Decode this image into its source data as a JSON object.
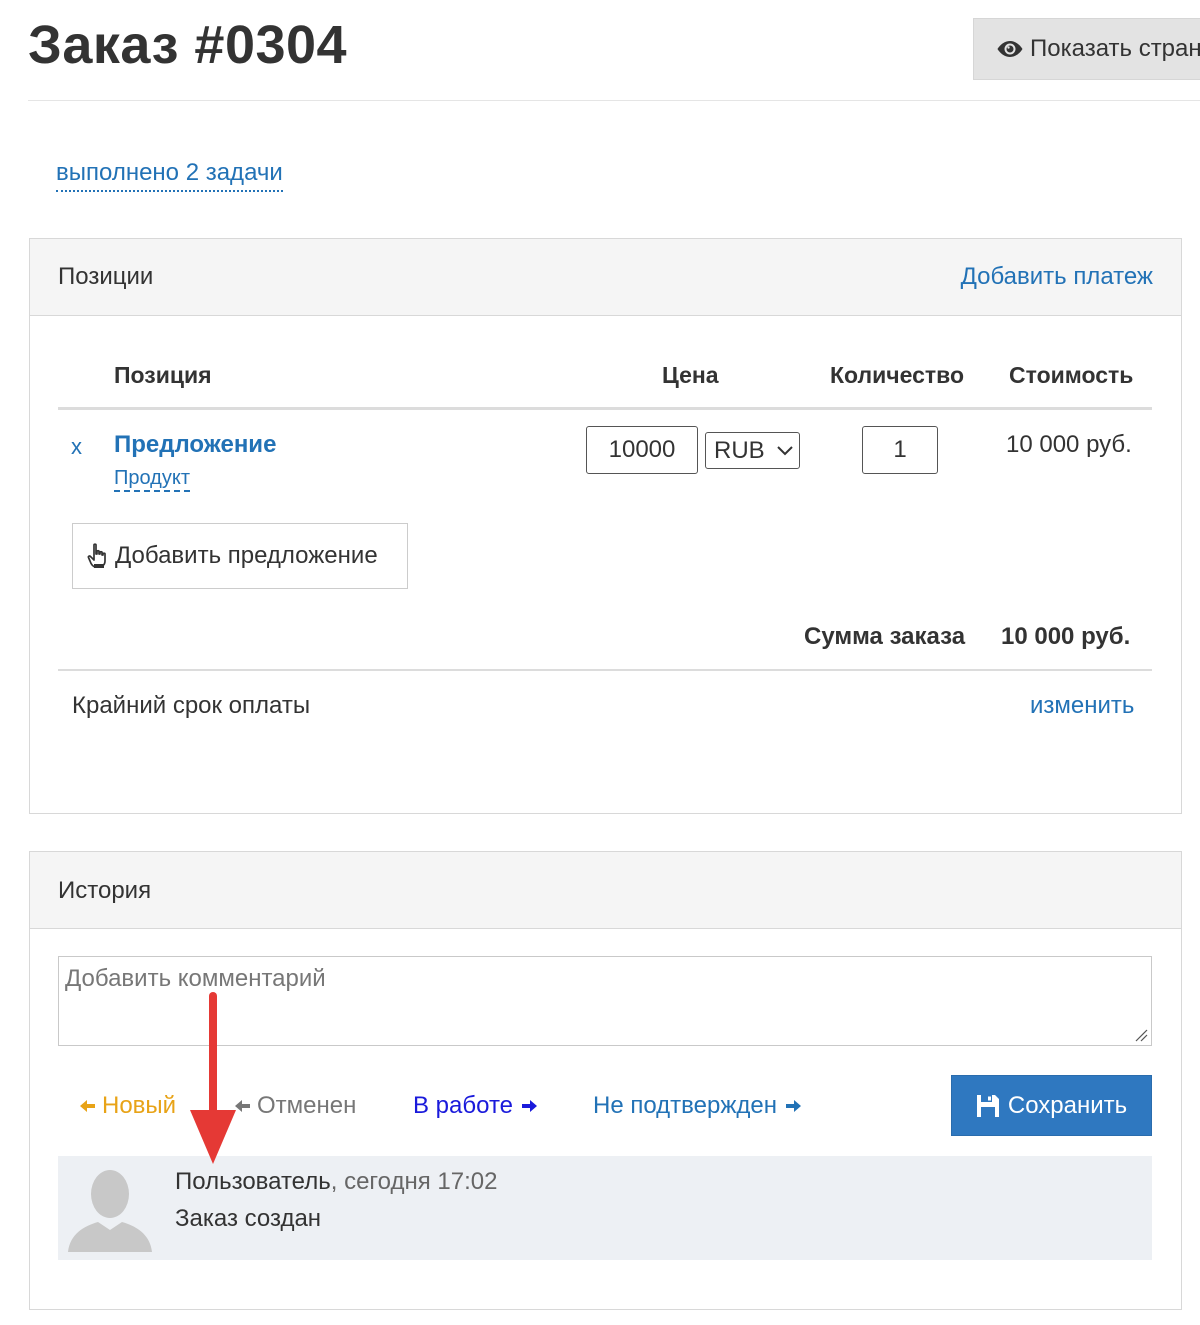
{
  "header": {
    "title": "Заказ #0304",
    "show_page_button": "Показать стран"
  },
  "tasks_link": "выполнено 2 задачи",
  "positions_panel": {
    "title": "Позиции",
    "add_payment": "Добавить платеж",
    "columns": {
      "position": "Позиция",
      "price": "Цена",
      "quantity": "Количество",
      "cost": "Стоимость"
    },
    "rows": [
      {
        "remove": "x",
        "name": "Предложение",
        "type": "Продукт",
        "price": "10000",
        "currency": "RUB",
        "quantity": "1",
        "cost": "10 000 руб."
      }
    ],
    "add_offer_button": "Добавить предложение",
    "total_label": "Сумма заказа",
    "total_value": "10 000 руб.",
    "deadline_label": "Крайний срок оплаты",
    "deadline_change": "изменить"
  },
  "history_panel": {
    "title": "История",
    "comment_placeholder": "Добавить комментарий",
    "statuses": {
      "new": "Новый",
      "canceled": "Отменен",
      "in_progress": "В работе",
      "not_confirmed": "Не подтвержден"
    },
    "save_button": "Сохранить",
    "entries": [
      {
        "user": "Пользователь",
        "time": ", сегодня 17:02",
        "text": "Заказ создан"
      }
    ]
  },
  "colors": {
    "link": "#2272b6",
    "status_new": "#e8a317",
    "status_canceled": "#777777",
    "status_in_progress": "#1a1adb",
    "save_button": "#2f78c0",
    "annotation_arrow": "#e53935"
  },
  "icons": {
    "show_page": "eye-icon",
    "add_offer": "pointing-hand-icon",
    "save": "floppy-disk-icon",
    "avatar": "user-silhouette-icon"
  }
}
